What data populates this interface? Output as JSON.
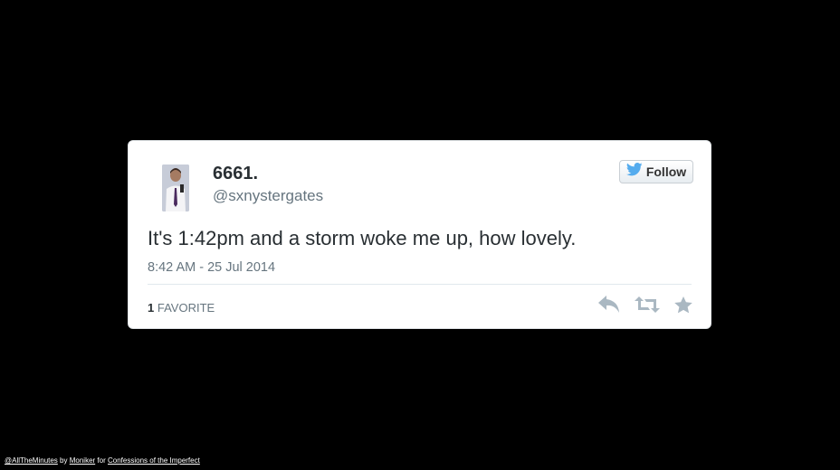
{
  "tweet": {
    "display_name": "6661.",
    "handle": "@sxnystergates",
    "follow_label": "Follow",
    "text": "It's 1:42pm and a storm woke me up, how lovely.",
    "timestamp": "8:42 AM - 25 Jul 2014",
    "stats": {
      "favorites_count": "1",
      "favorites_label": "FAVORITE"
    },
    "icons": {
      "follow": "twitter-bird-icon",
      "reply": "reply-icon",
      "retweet": "retweet-icon",
      "favorite": "star-icon"
    }
  },
  "credit": {
    "account_link": "@AllTheMinutes",
    "by_text": "by",
    "author_link": "Moniker",
    "for_text": "for",
    "project_link": "Confessions of the Imperfect"
  },
  "colors": {
    "background": "#000000",
    "card": "#ffffff",
    "text_primary": "#292f33",
    "text_secondary": "#66757f",
    "twitter_blue": "#55acee",
    "action_icon": "#aab8c2"
  }
}
